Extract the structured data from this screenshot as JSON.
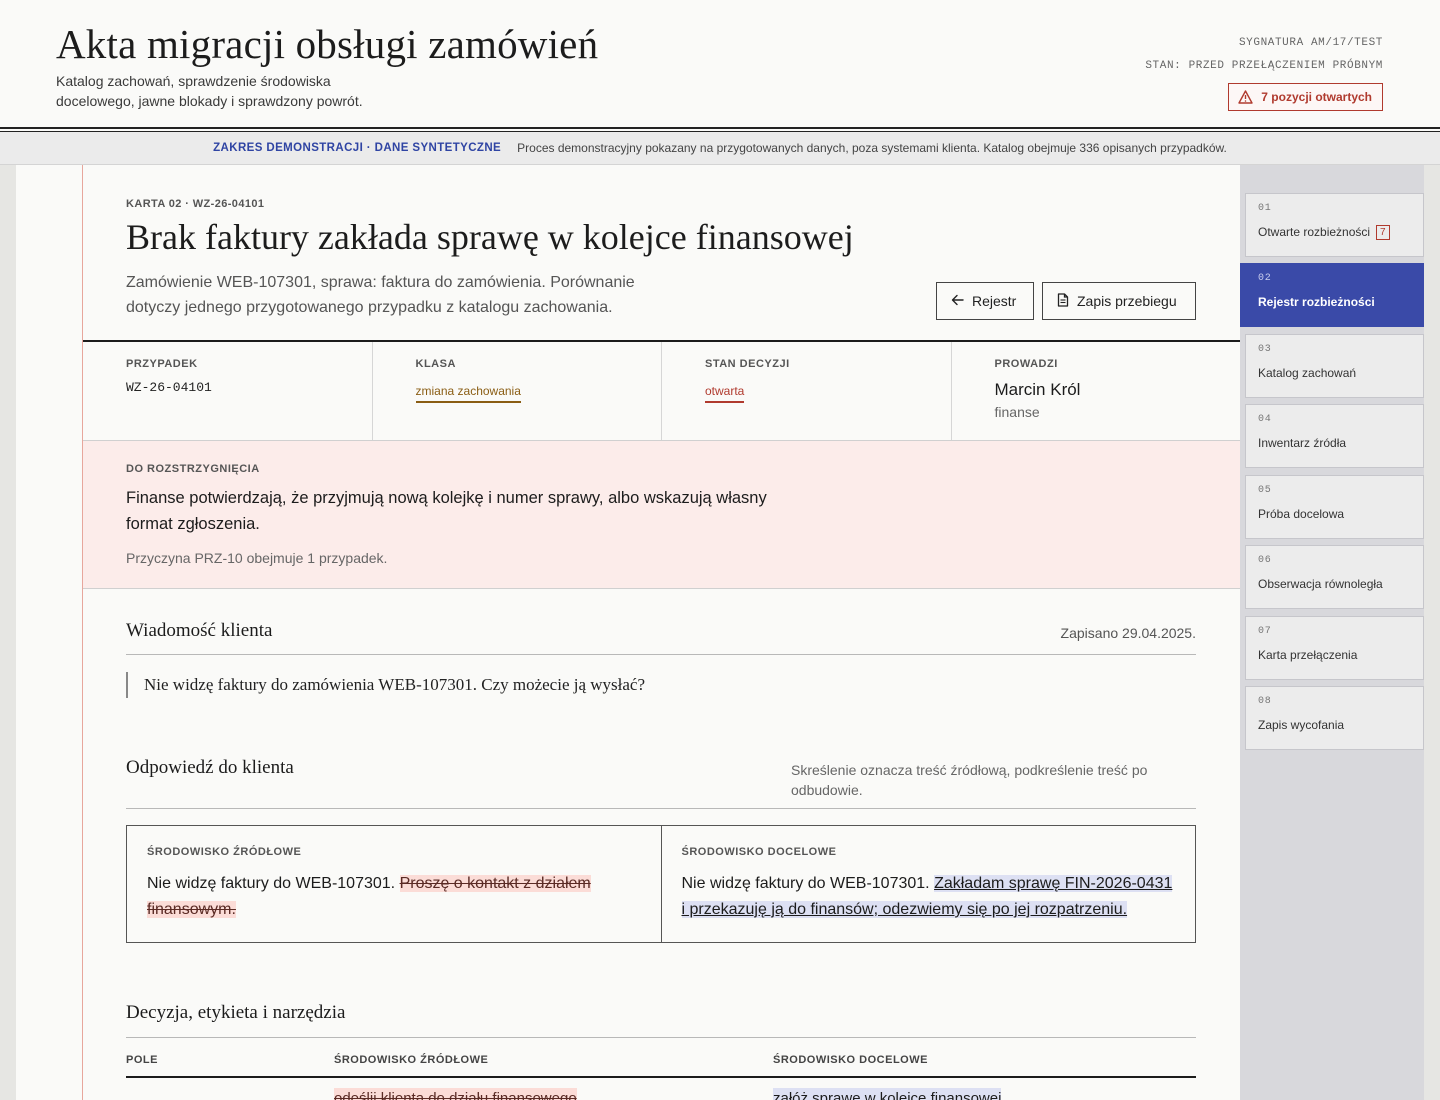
{
  "header": {
    "title": "Akta migracji obsługi zamówień",
    "subtitle": "Katalog zachowań, sprawdzenie środowiska docelowego, jawne blokady i sprawdzony powrót.",
    "signature": "SYGNATURA AM/17/TEST",
    "state": "STAN: PRZED PRZEŁĄCZENIEM PRÓBNYM",
    "open_badge": "7 pozycji otwartych"
  },
  "demo": {
    "tag": "ZAKRES DEMONSTRACJI · DANE SYNTETYCZNE",
    "text": "Proces demonstracyjny pokazany na przygotowanych danych, poza systemami klienta. Katalog obejmuje 336 opisanych przypadków."
  },
  "card": {
    "code": "KARTA 02 · WZ-26-04101",
    "title": "Brak faktury zakłada sprawę w kolejce finansowej",
    "description": "Zamówienie WEB-107301, sprawa: faktura do zamówienia. Porównanie dotyczy jednego przygotowanego przypadku z katalogu zachowania.",
    "back_button": "Rejestr",
    "log_button": "Zapis przebiegu"
  },
  "meta": {
    "case_label": "PRZYPADEK",
    "case_value": "WZ-26-04101",
    "class_label": "KLASA",
    "class_value": "zmiana zachowania",
    "decision_label": "STAN DECYZJI",
    "decision_value": "otwarta",
    "owner_label": "PROWADZI",
    "owner_name": "Marcin Król",
    "owner_dept": "finanse"
  },
  "resolution": {
    "label": "DO ROZSTRZYGNIĘCIA",
    "text": "Finanse potwierdzają, że przyjmują nową kolejkę i numer sprawy, albo wskazują własny format zgłoszenia.",
    "note": "Przyczyna PRZ-10 obejmuje 1 przypadek."
  },
  "client_message": {
    "title": "Wiadomość klienta",
    "saved": "Zapisano 29.04.2025.",
    "quote": "Nie widzę faktury do zamówienia WEB-107301. Czy możecie ją wysłać?"
  },
  "reply": {
    "title": "Odpowiedź do klienta",
    "legend": "Skreślenie oznacza treść źródłową, podkreślenie treść po odbudowie.",
    "source_label": "ŚRODOWISKO ŹRÓDŁOWE",
    "source_plain": "Nie widzę faktury do WEB-107301. ",
    "source_deleted": "Proszę o kontakt z działem finansowym.",
    "target_label": "ŚRODOWISKO DOCELOWE",
    "target_plain": "Nie widzę faktury do WEB-107301. ",
    "target_inserted": "Zakładam sprawę FIN-2026-0431 i przekazuję ją do finansów; odezwiemy się po jej rozpatrzeniu."
  },
  "decision": {
    "title": "Decyzja, etykieta i narzędzia",
    "columns": [
      "POLE",
      "ŚRODOWISKO ŹRÓDŁOWE",
      "ŚRODOWISKO DOCELOWE"
    ],
    "first_row_source": "odeślij klienta do działu finansowego",
    "first_row_target": "załóż sprawę w kolejce finansowej"
  },
  "nav": {
    "items": [
      {
        "num": "01",
        "label": "Otwarte rozbieżności",
        "count": "7"
      },
      {
        "num": "02",
        "label": "Rejestr rozbieżności"
      },
      {
        "num": "03",
        "label": "Katalog zachowań"
      },
      {
        "num": "04",
        "label": "Inwentarz źródła"
      },
      {
        "num": "05",
        "label": "Próba docelowa"
      },
      {
        "num": "06",
        "label": "Obserwacja równoległa"
      },
      {
        "num": "07",
        "label": "Karta przełączenia"
      },
      {
        "num": "08",
        "label": "Zapis wycofania"
      }
    ],
    "active_index": 1
  },
  "colors": {
    "accent": "#3a4aa8",
    "alert": "#b03a2e",
    "class_tag": "#8a5d14",
    "resolve_bg": "#fcecea"
  }
}
